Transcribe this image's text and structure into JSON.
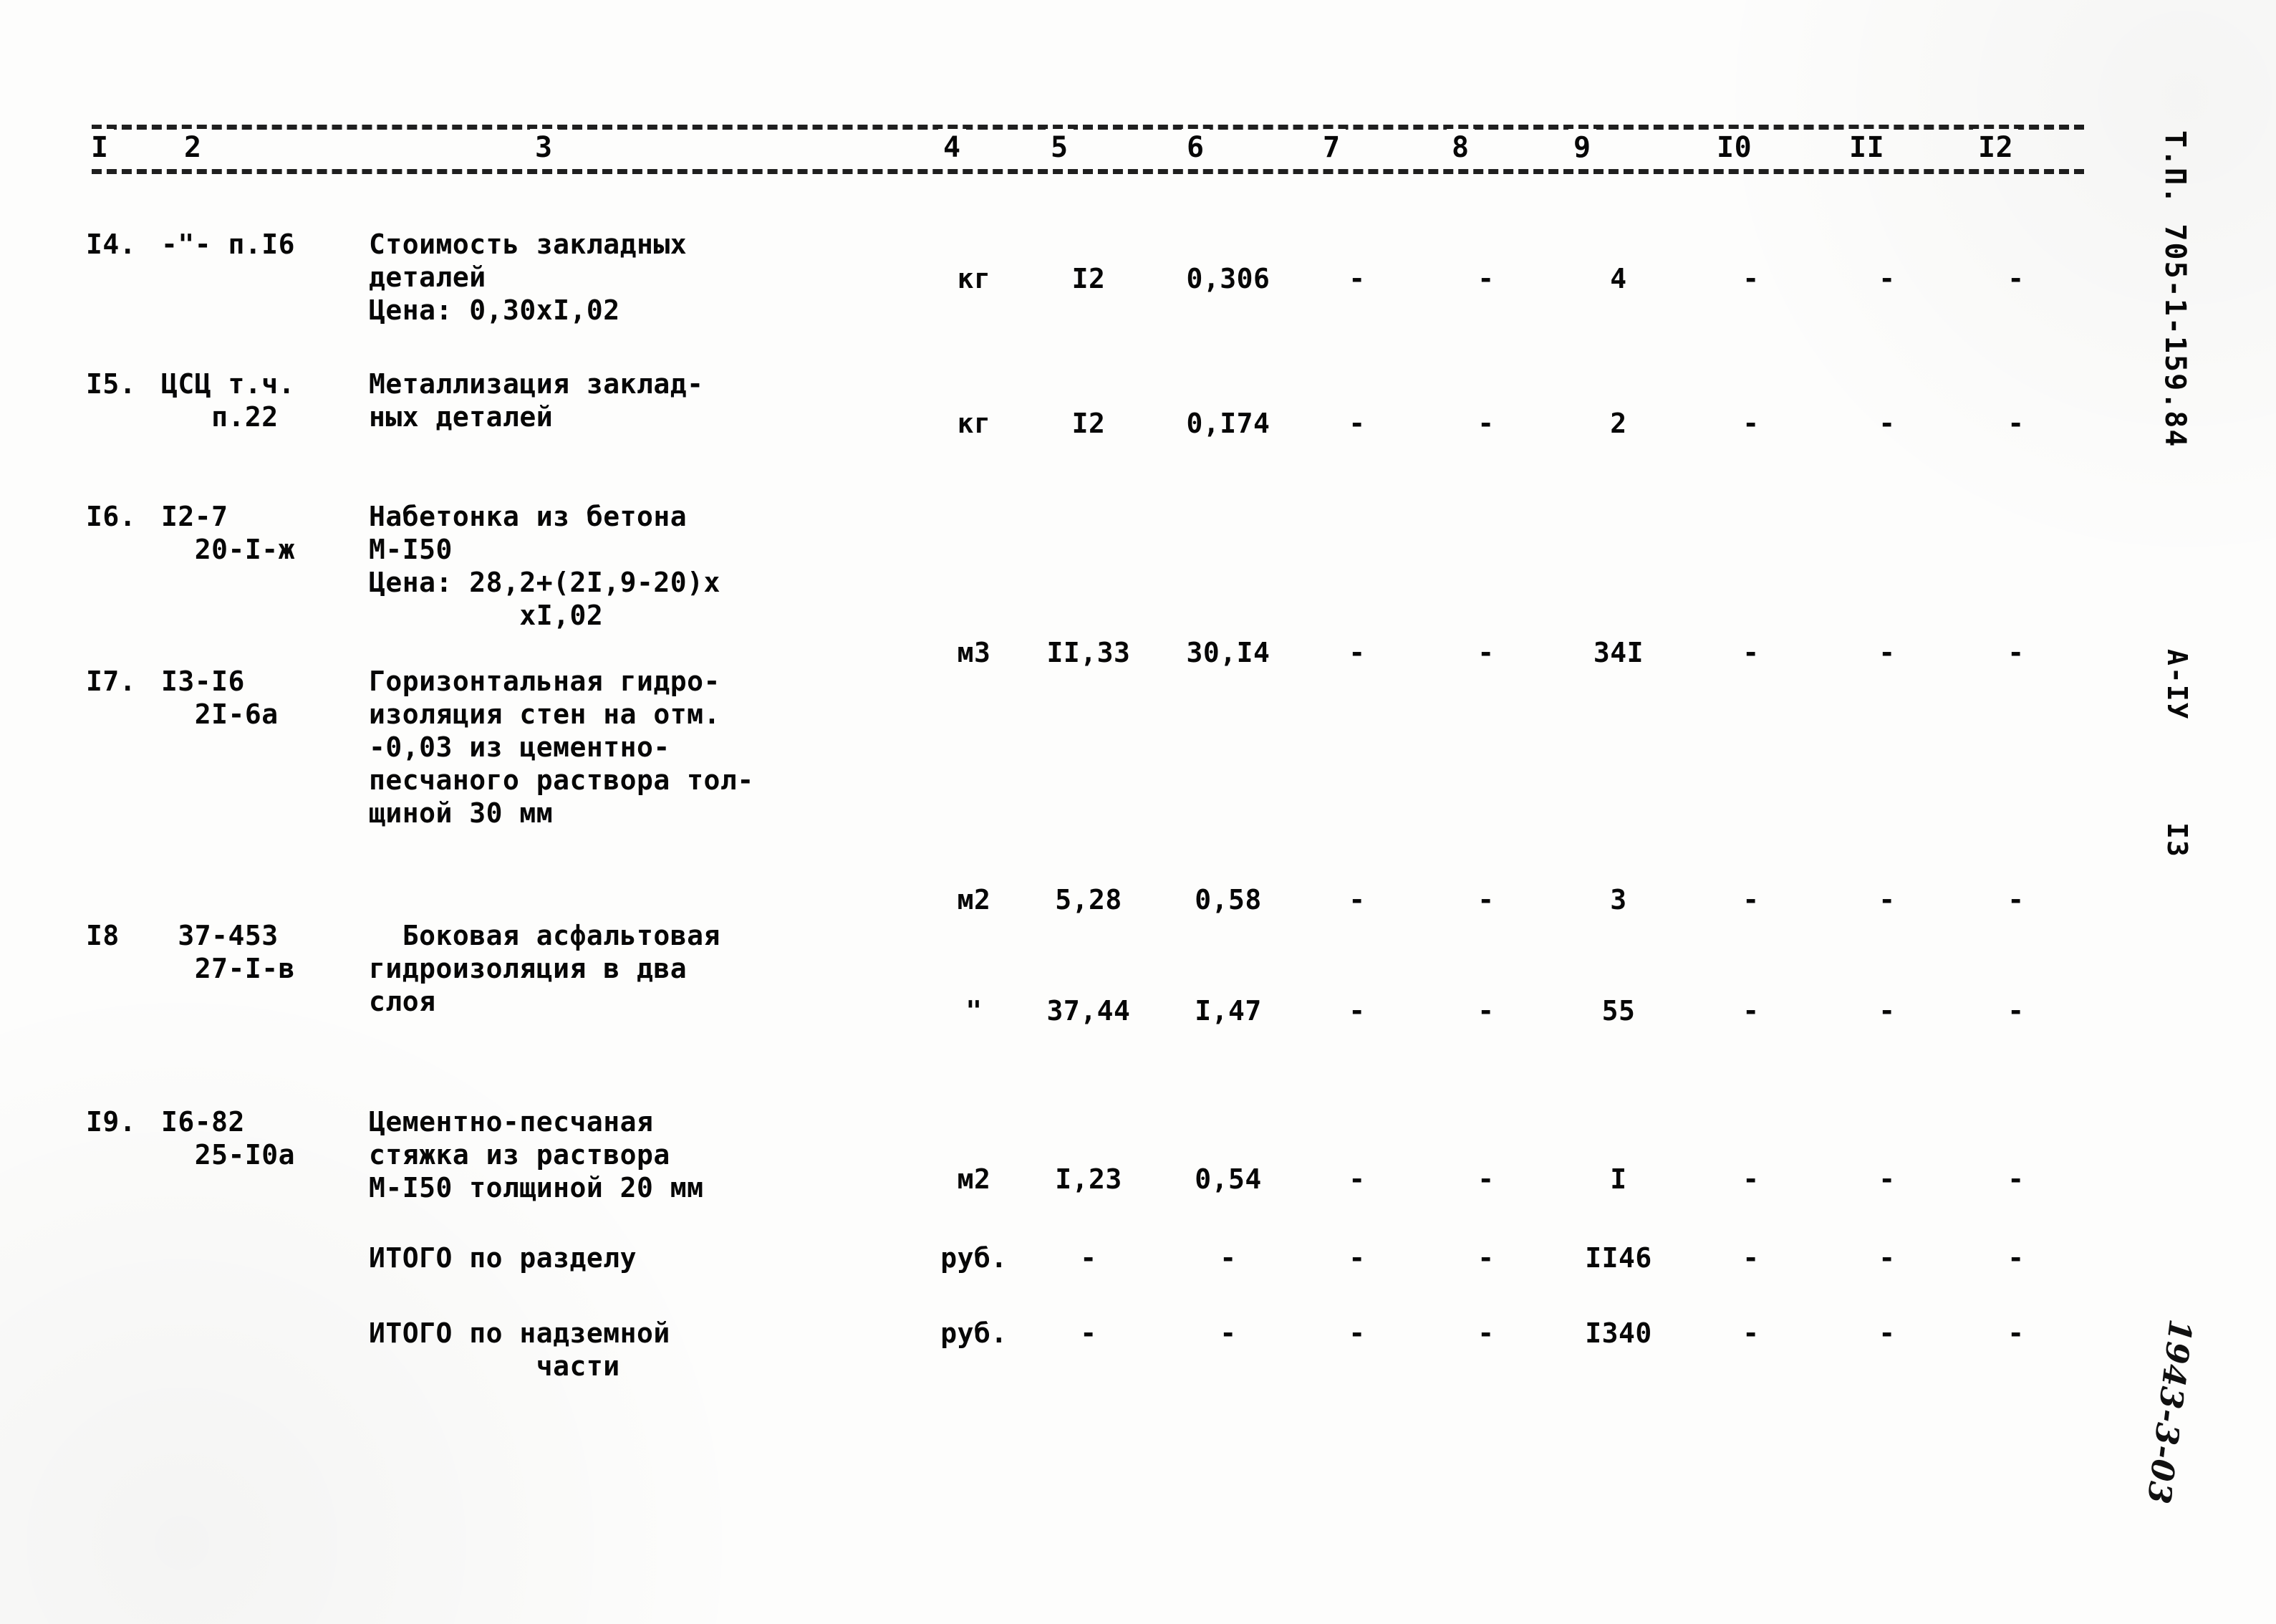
{
  "document": {
    "stamp": "Т.П. 705-1-159.84",
    "series": "А-IУ",
    "page_number": "I3",
    "handwritten_mark": "1943-3-03"
  },
  "table": {
    "column_headers": [
      "I",
      "2",
      "3",
      "4",
      "5",
      "6",
      "7",
      "8",
      "9",
      "I0",
      "II",
      "I2"
    ],
    "rows": [
      {
        "num": "I4.",
        "code": [
          "-\"- п.I6"
        ],
        "desc": [
          "Стоимость закладных",
          "деталей",
          "Цена: 0,30хI,02"
        ],
        "unit": "кг",
        "c5": "I2",
        "c6": "0,306",
        "c7": "-",
        "c8": "-",
        "c9": "4",
        "c10": "-",
        "c11": "-",
        "c12": "-"
      },
      {
        "num": "I5.",
        "code": [
          "ЦСЦ т.ч.",
          "   п.22"
        ],
        "desc": [
          "Металлизация заклад-",
          "ных деталей"
        ],
        "unit": "кг",
        "c5": "I2",
        "c6": "0,I74",
        "c7": "-",
        "c8": "-",
        "c9": "2",
        "c10": "-",
        "c11": "-",
        "c12": "-"
      },
      {
        "num": "I6.",
        "code": [
          "I2-7",
          "  20-I-ж"
        ],
        "desc": [
          "Набетонка из бетона",
          "М-I50",
          "Цена: 28,2+(2I,9-20)х",
          "         хI,02"
        ],
        "unit": "м3",
        "c5": "II,33",
        "c6": "30,I4",
        "c7": "-",
        "c8": "-",
        "c9": "34I",
        "c10": "-",
        "c11": "-",
        "c12": "-"
      },
      {
        "num": "I7.",
        "code": [
          "I3-I6",
          "  2I-6а"
        ],
        "desc": [
          "Горизонтальная гидро-",
          "изоляция стен на отм.",
          "-0,03 из цементно-",
          "песчаного раствора тол-",
          "щиной 30 мм"
        ],
        "unit": "м2",
        "c5": "5,28",
        "c6": "0,58",
        "c7": "-",
        "c8": "-",
        "c9": "3",
        "c10": "-",
        "c11": "-",
        "c12": "-"
      },
      {
        "num": "I8",
        "code": [
          " 37-453",
          "  27-I-в"
        ],
        "desc": [
          "  Боковая асфальтовая",
          "гидроизоляция в два",
          "слоя"
        ],
        "unit": "\"",
        "c5": "37,44",
        "c6": "I,47",
        "c7": "-",
        "c8": "-",
        "c9": "55",
        "c10": "-",
        "c11": "-",
        "c12": "-"
      },
      {
        "num": "I9.",
        "code": [
          "I6-82",
          "  25-I0а"
        ],
        "desc": [
          "Цементно-песчаная",
          "стяжка из раствора",
          "М-I50 толщиной 20 мм"
        ],
        "unit": "м2",
        "c5": "I,23",
        "c6": "0,54",
        "c7": "-",
        "c8": "-",
        "c9": "I",
        "c10": "-",
        "c11": "-",
        "c12": "-"
      },
      {
        "num": "",
        "code": [],
        "desc": [
          "ИТОГО по разделу"
        ],
        "unit": "руб.",
        "c5": "-",
        "c6": "-",
        "c7": "-",
        "c8": "-",
        "c9": "II46",
        "c10": "-",
        "c11": "-",
        "c12": "-"
      },
      {
        "num": "",
        "code": [],
        "desc": [
          "ИТОГО по надземной",
          "          части"
        ],
        "unit": "руб.",
        "c5": "-",
        "c6": "-",
        "c7": "-",
        "c8": "-",
        "c9": "I340",
        "c10": "-",
        "c11": "-",
        "c12": "-"
      }
    ]
  }
}
